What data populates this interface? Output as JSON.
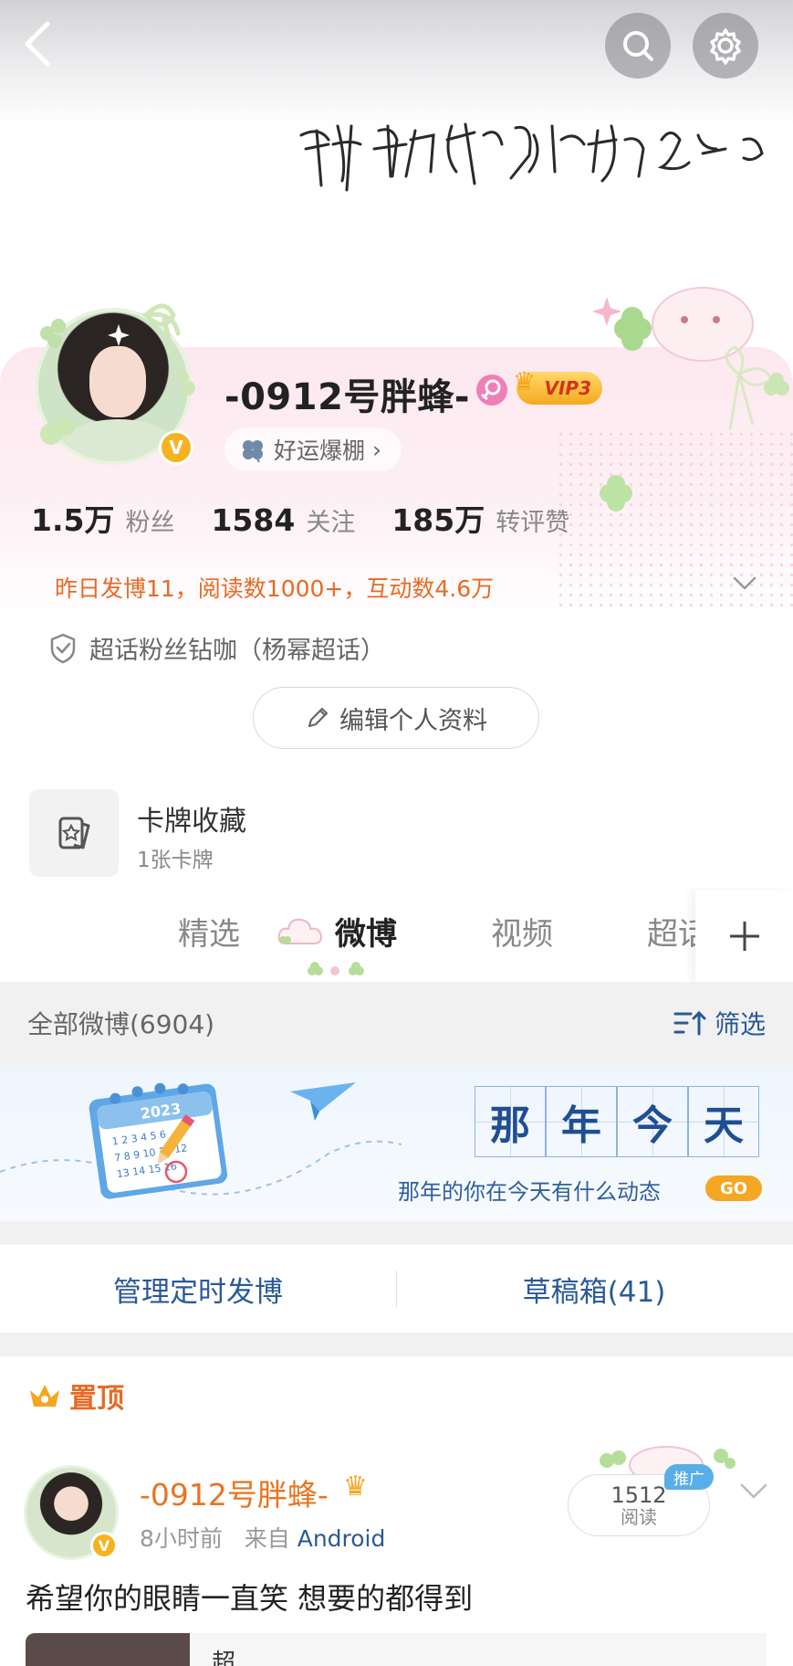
{
  "header": {
    "signature_text": "谢谢你成为了我的nn分之n"
  },
  "profile": {
    "nickname": "-0912号胖蜂-",
    "vip_label": "VIP3",
    "luck_chip": "好运爆棚",
    "luck_chevron": "›",
    "stats": [
      {
        "value": "1.5万",
        "label": "粉丝"
      },
      {
        "value": "1584",
        "label": "关注"
      },
      {
        "value": "185万",
        "label": "转评赞"
      }
    ],
    "yesterday_summary": "昨日发博11，阅读数1000+，互动数4.6万",
    "supertopic_badge": "超话粉丝钻咖（杨幂超话）",
    "edit_profile_label": "编辑个人资料"
  },
  "card_collection": {
    "title": "卡牌收藏",
    "subtitle": "1张卡牌"
  },
  "tabs": [
    {
      "label": "精选",
      "active": false
    },
    {
      "label": "微博",
      "active": true
    },
    {
      "label": "视频",
      "active": false
    },
    {
      "label": "超话",
      "active": false
    }
  ],
  "filter_bar": {
    "all_label": "全部微博(6904)",
    "filter_label": "筛选"
  },
  "memory_banner": {
    "title_chars": [
      "那",
      "年",
      "今",
      "天"
    ],
    "subtitle": "那年的你在今天有什么动态",
    "go_label": "GO",
    "calendar_year": "2023"
  },
  "drafts": {
    "scheduled_label": "管理定时发博",
    "drafts_label": "草稿箱(41)"
  },
  "pinned_label": "置顶",
  "post": {
    "author": "-0912号胖蜂-",
    "time": "8小时前",
    "source_prefix": "来自",
    "source": "Android",
    "read_count": "1512",
    "read_label": "阅读",
    "promo_tag": "推广",
    "text": "希望你的眼睛一直笑 想要的都得到",
    "link_card_text": "超……"
  },
  "colors": {
    "accent_orange": "#e86a24",
    "link_blue": "#2a5a96",
    "vip_gold": "#f6a91f",
    "verified_gold": "#f5b321"
  }
}
